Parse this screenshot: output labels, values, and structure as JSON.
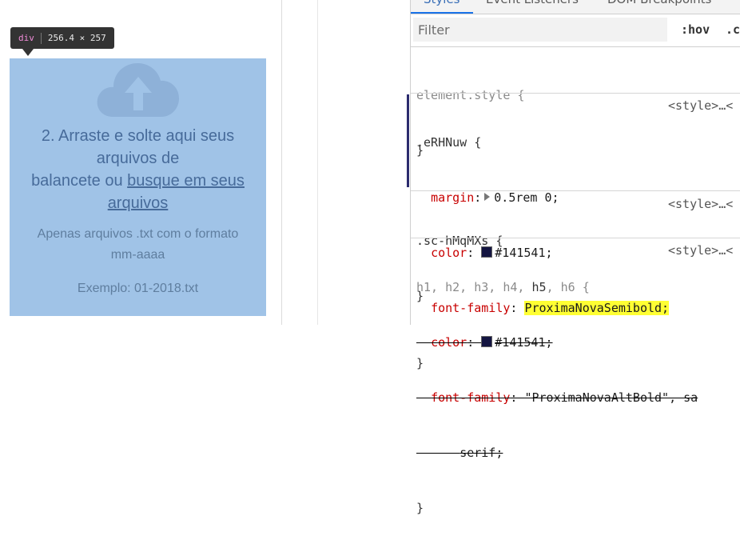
{
  "tooltip": {
    "tag": "div",
    "dimensions": "256.4 × 257"
  },
  "dropzone": {
    "title_line1": "2. Arraste e solte aqui seus",
    "title_line2": "arquivos de",
    "title_line3_prefix": "balancete ou ",
    "title_link_part1": "busque em seus",
    "title_link_part2": "arquivos",
    "subtitle_line1": "Apenas arquivos .txt com o formato",
    "subtitle_line2": "mm-aaaa",
    "example": "Exemplo: 01-2018.txt",
    "colors": {
      "background": "#a0c3e7",
      "title": "#476b9a",
      "cloud": "#8eb1d8"
    },
    "cloud_icon": "cloud-upload-icon"
  },
  "devtools": {
    "tabs": [
      "Styles",
      "Event Listeners",
      "DOM Breakpoints"
    ],
    "filter_placeholder": "Filter",
    "hov_label": ":hov",
    "cls_label": ".c",
    "rules": [
      {
        "selector": "element.style {",
        "closing": "}"
      },
      {
        "selector": ".eRHNuw {",
        "source": "<style>…<",
        "declarations": [
          {
            "prop": "margin",
            "value": "0.5rem 0;"
          },
          {
            "prop": "color",
            "value": "#141541;"
          },
          {
            "prop": "font-family",
            "value": "ProximaNovaSemibold;"
          }
        ],
        "closing": "}"
      },
      {
        "selector": ".sc-hMqMXs {",
        "source": "<style>…<",
        "closing": "}"
      },
      {
        "selector_dim": "h1, h2, h3, h4,",
        "selector_active": "h5",
        "selector_tail": ", h6 {",
        "source": "<style>…<",
        "declarations": [
          {
            "prop": "color",
            "value": "#141541;"
          },
          {
            "prop": "font-family",
            "value": "\"ProximaNovaAltBold\", sa"
          },
          {
            "prop": "",
            "value": "serif;"
          }
        ],
        "closing": "}"
      }
    ],
    "colors": {
      "swatch": "#141541",
      "highlight": "#ffff33",
      "property": "#c80000"
    }
  }
}
